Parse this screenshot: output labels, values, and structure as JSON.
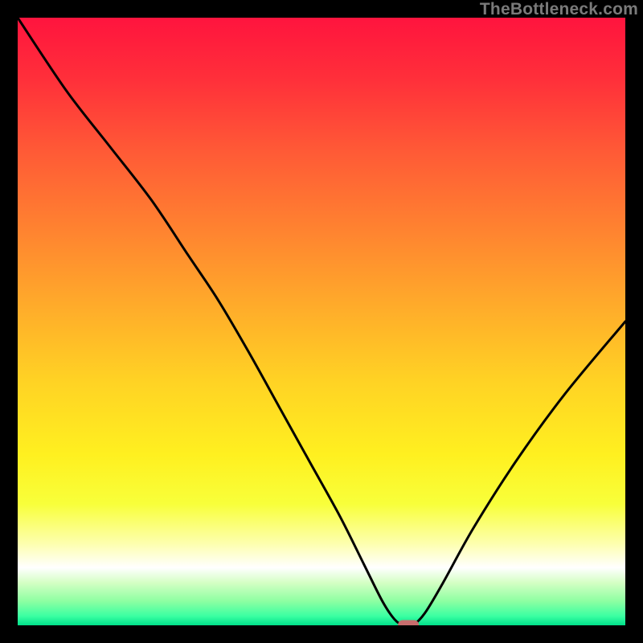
{
  "watermark": "TheBottleneck.com",
  "chart_data": {
    "type": "line",
    "title": "",
    "xlabel": "",
    "ylabel": "",
    "xlim": [
      0,
      100
    ],
    "ylim": [
      0,
      100
    ],
    "grid": false,
    "legend": false,
    "series": [
      {
        "name": "curve",
        "x": [
          0,
          8,
          15,
          22,
          28,
          33,
          38,
          43,
          48,
          53,
          57,
          60,
          62,
          63.5,
          65,
          67,
          70,
          75,
          82,
          90,
          100
        ],
        "values": [
          100,
          88,
          79,
          70,
          61,
          53.5,
          45,
          36,
          27,
          18,
          10,
          4,
          1,
          0,
          0,
          2,
          7,
          16,
          27,
          38,
          50
        ]
      }
    ],
    "marker": {
      "x": 64.3,
      "y": 0,
      "color": "#c76d6d",
      "shape": "rounded-rect"
    },
    "gradient_stops": [
      {
        "offset": 0.0,
        "color": "#ff143e"
      },
      {
        "offset": 0.1,
        "color": "#ff2f3a"
      },
      {
        "offset": 0.22,
        "color": "#ff5a36"
      },
      {
        "offset": 0.35,
        "color": "#ff8330"
      },
      {
        "offset": 0.48,
        "color": "#ffad2a"
      },
      {
        "offset": 0.6,
        "color": "#ffd324"
      },
      {
        "offset": 0.72,
        "color": "#fff020"
      },
      {
        "offset": 0.8,
        "color": "#f8ff3a"
      },
      {
        "offset": 0.865,
        "color": "#fdffad"
      },
      {
        "offset": 0.905,
        "color": "#ffffff"
      },
      {
        "offset": 0.93,
        "color": "#d4ffc4"
      },
      {
        "offset": 0.96,
        "color": "#8effa2"
      },
      {
        "offset": 0.985,
        "color": "#3affa2"
      },
      {
        "offset": 1.0,
        "color": "#00e08a"
      }
    ]
  }
}
